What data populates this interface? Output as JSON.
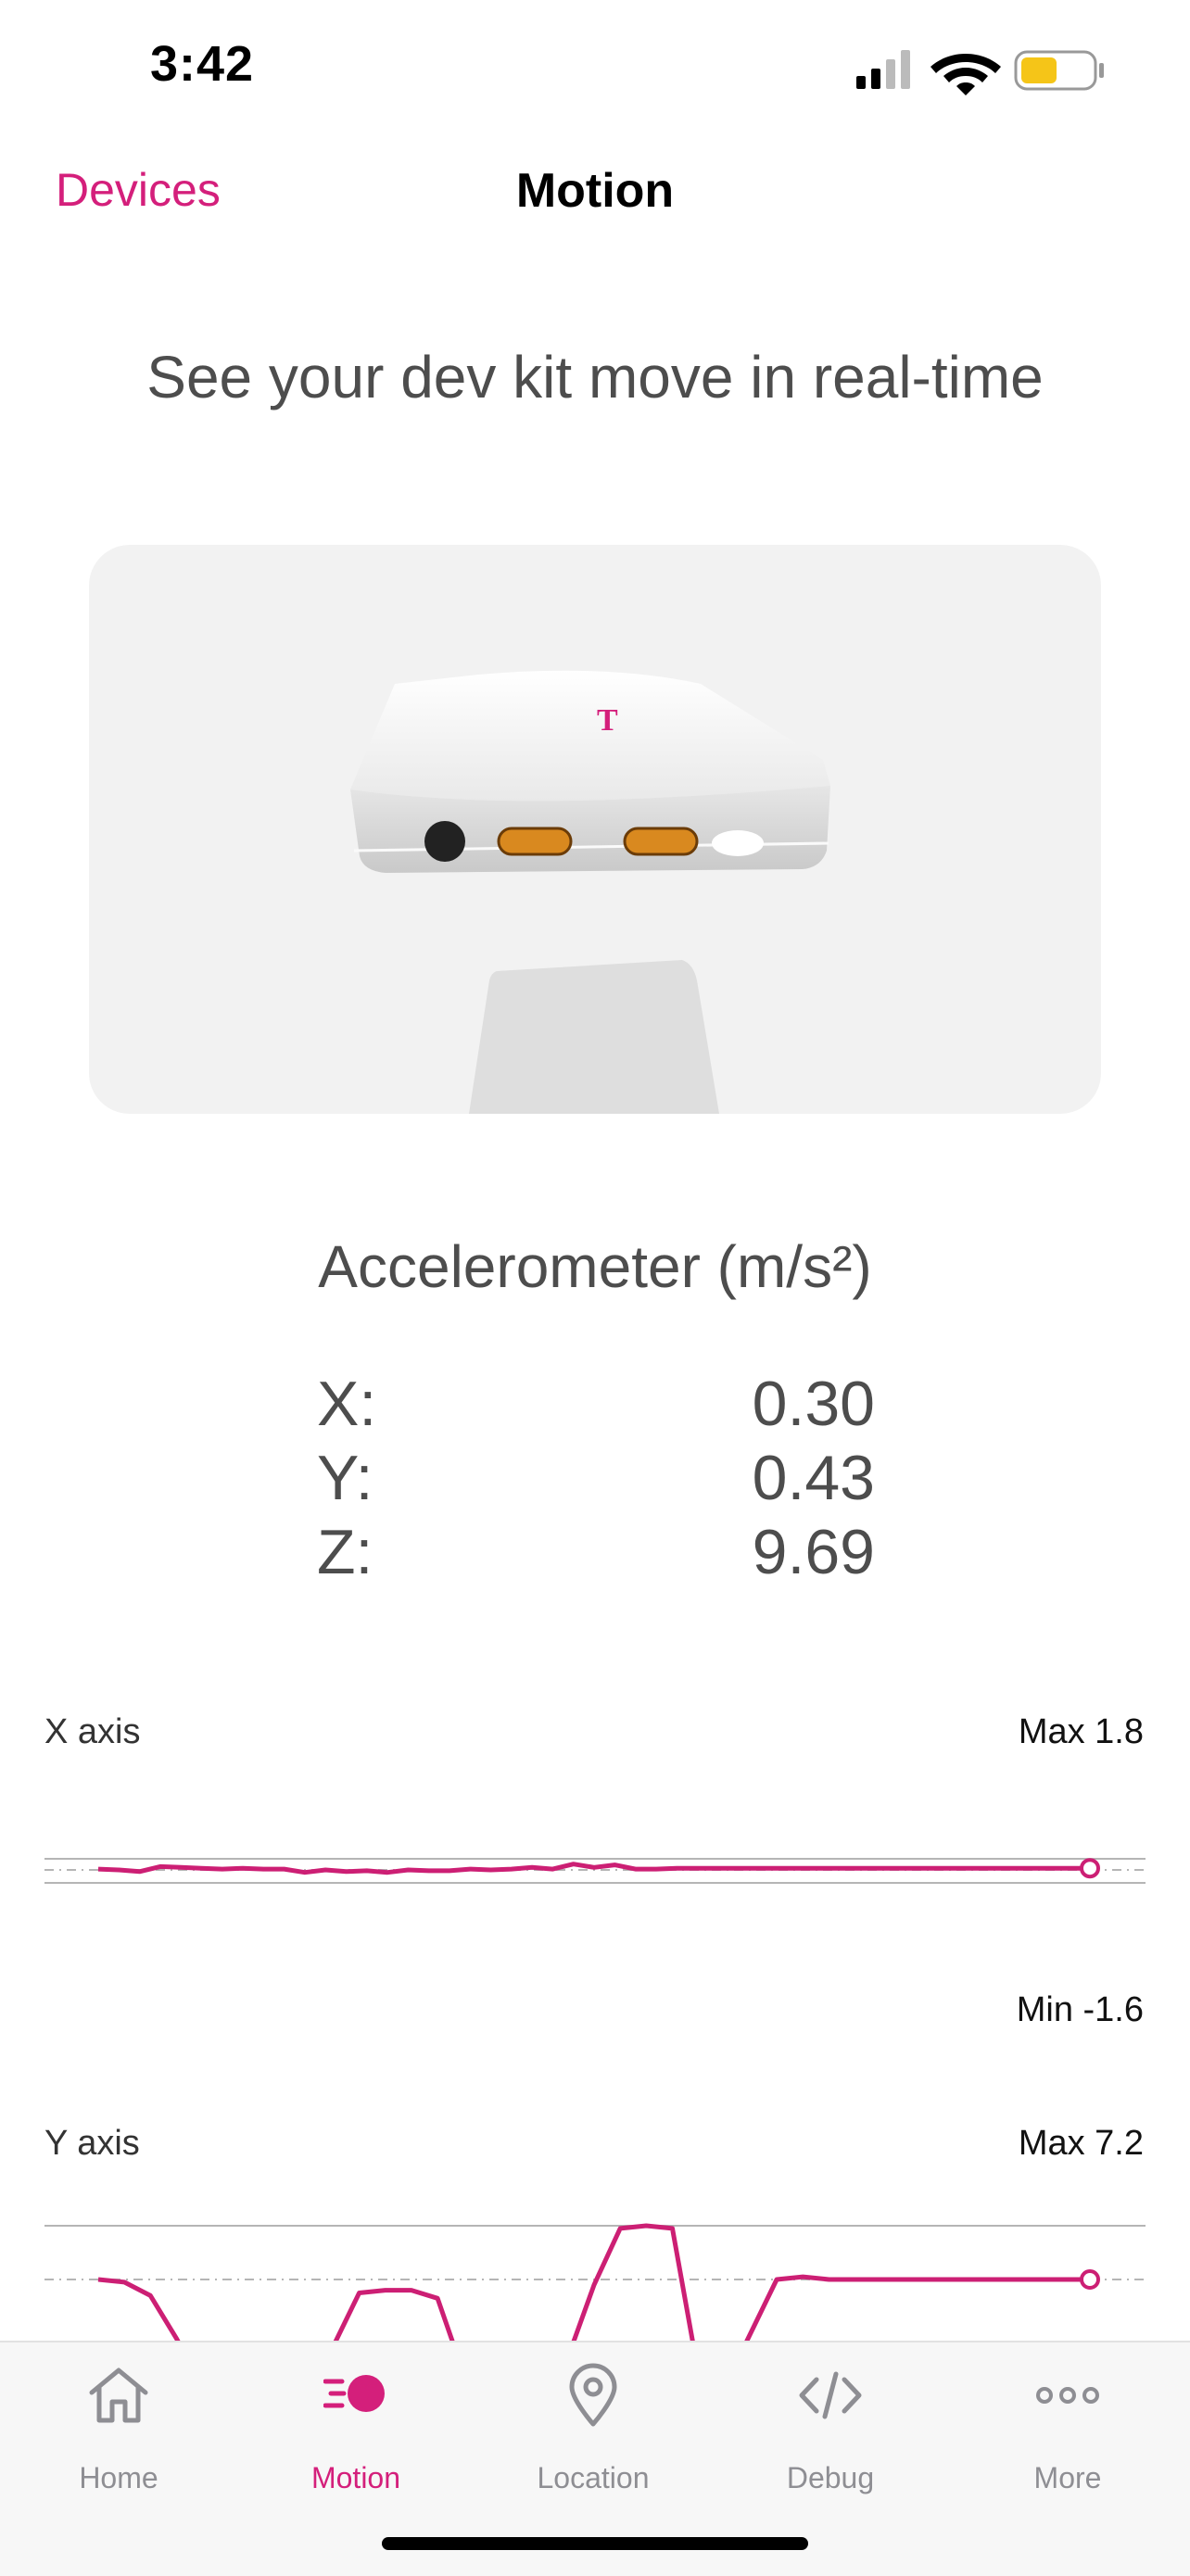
{
  "status_bar": {
    "time": "3:42",
    "battery_color": "#f5c518"
  },
  "nav": {
    "back_label": "Devices",
    "title": "Motion"
  },
  "headline": "See your dev kit move in real-time",
  "device_image": {
    "icon": "t-mobile-dev-kit-3d-model",
    "brand_mark": "T"
  },
  "accelerometer": {
    "title": "Accelerometer (m/s²)",
    "rows": [
      {
        "label": "X:",
        "value": "0.30"
      },
      {
        "label": "Y:",
        "value": "0.43"
      },
      {
        "label": "Z:",
        "value": "9.69"
      }
    ]
  },
  "charts": {
    "x_axis": {
      "name": "X axis",
      "max_label": "Max 1.8",
      "min_label": "Min -1.6"
    },
    "y_axis": {
      "name": "Y axis",
      "max_label": "Max 7.2"
    }
  },
  "chart_data": [
    {
      "type": "line",
      "title": "X axis",
      "ylim": [
        -1.6,
        1.8
      ],
      "series": [
        {
          "values": [
            0.1,
            0.0,
            -0.2,
            0.4,
            0.3,
            0.2,
            0.1,
            0.2,
            0.1,
            0.1,
            -0.3,
            0.0,
            -0.2,
            -0.1,
            -0.3,
            0.0,
            -0.1,
            -0.1,
            0.1,
            0.0,
            0.1,
            0.3,
            0.1,
            0.7,
            0.3,
            0.6,
            0.1,
            0.1,
            0.2,
            0.2,
            0.2,
            0.2,
            0.2,
            0.2,
            0.2,
            0.2,
            0.2,
            0.2,
            0.2,
            0.2,
            0.2,
            0.2,
            0.2,
            0.2,
            0.2,
            0.2,
            0.2,
            0.2,
            0.2
          ]
        }
      ],
      "color": "#cc1f74"
    },
    {
      "type": "line",
      "title": "Y axis",
      "ylim": [
        0,
        7.2
      ],
      "series": [
        {
          "values": [
            4.0,
            3.9,
            3.4,
            1.8,
            0.0,
            0.0,
            0.0,
            0.0,
            0.0,
            1.5,
            3.5,
            3.6,
            3.6,
            3.3,
            0.5,
            0.0,
            0.8,
            0.9,
            1.1,
            3.8,
            5.9,
            6.0,
            5.9,
            0.5,
            0.0,
            2.0,
            4.0,
            4.1,
            4.0,
            4.0,
            4.0,
            4.0,
            4.0,
            4.0,
            4.0,
            4.0,
            4.0,
            4.0,
            4.0
          ]
        }
      ],
      "color": "#cc1f74"
    }
  ],
  "tabs": [
    {
      "label": "Home",
      "icon": "home-icon"
    },
    {
      "label": "Motion",
      "icon": "motion-icon",
      "active": true
    },
    {
      "label": "Location",
      "icon": "location-pin-icon"
    },
    {
      "label": "Debug",
      "icon": "code-icon"
    },
    {
      "label": "More",
      "icon": "more-dots-icon"
    }
  ],
  "colors": {
    "accent": "#d41f7b",
    "text": "#4d4d4d"
  }
}
